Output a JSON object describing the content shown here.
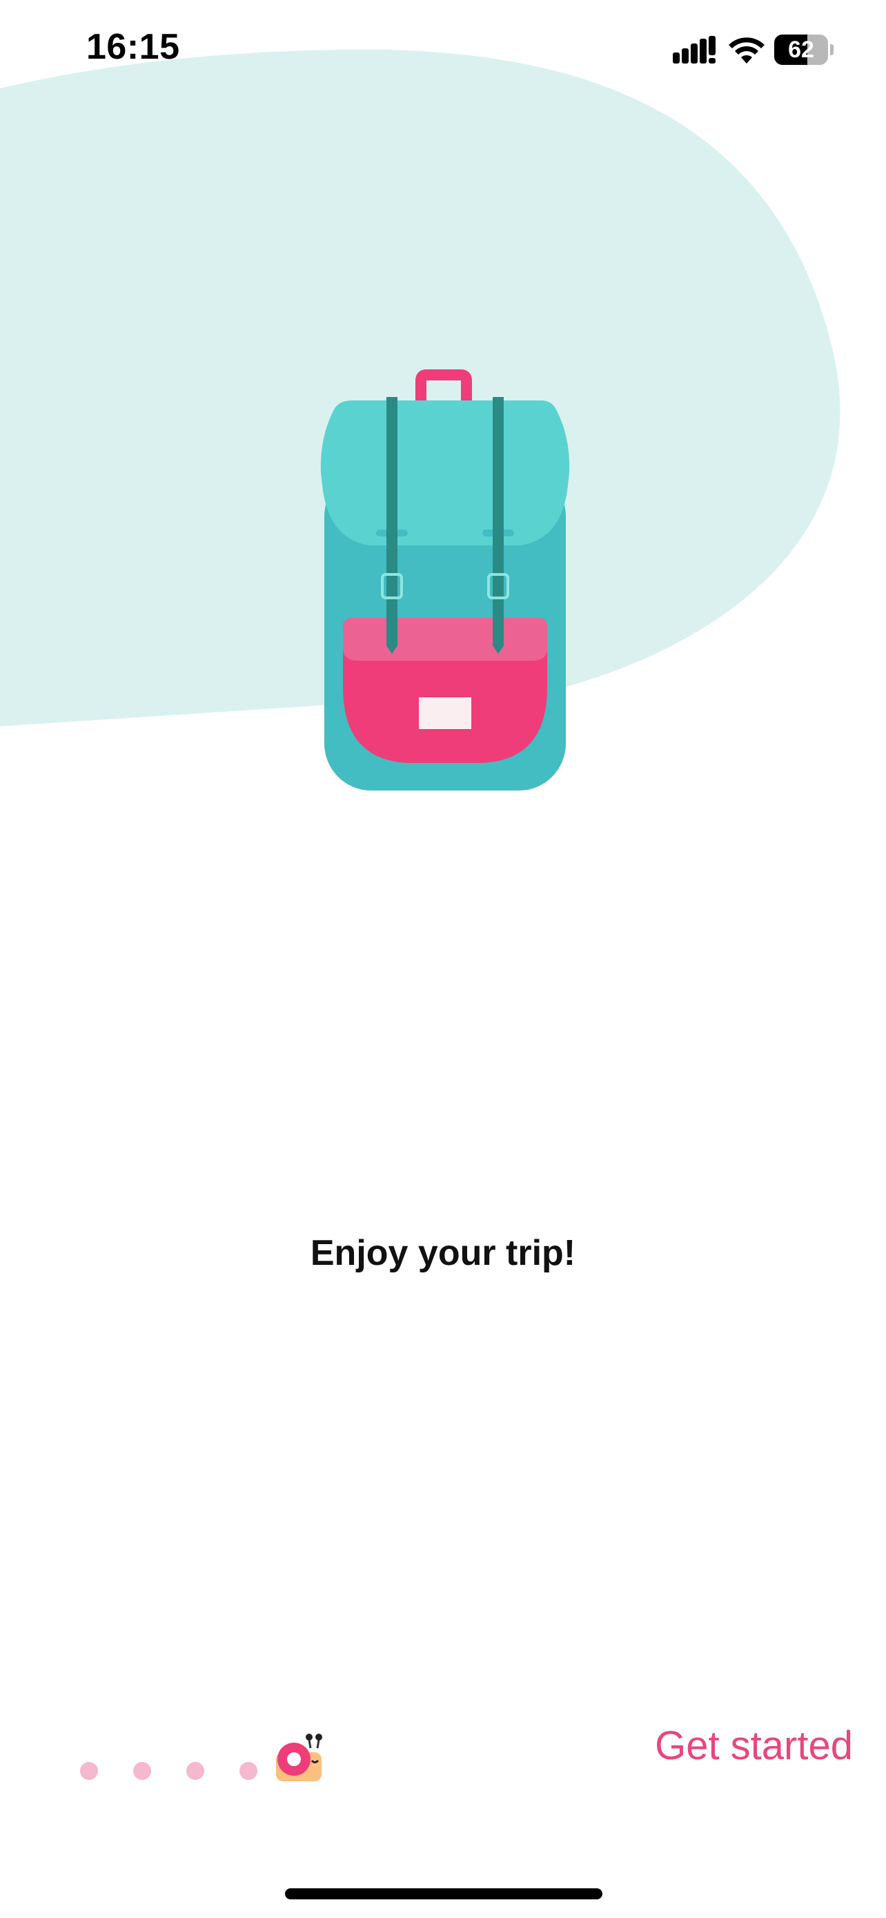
{
  "status_bar": {
    "time": "16:15",
    "battery_level": 62,
    "battery_label": "62"
  },
  "onboarding": {
    "headline": "Enjoy your trip!",
    "illustration": "backpack-illustration",
    "page_count": 5,
    "current_page": 5,
    "cta_label": "Get started"
  },
  "colors": {
    "accent": "#e8467d",
    "blob": "#daf1f0",
    "backpack_body": "#43bcc2",
    "backpack_flap": "#5ad3d0",
    "strap": "#2a8a84",
    "pocket": "#ee3d78",
    "dot": "#f5b8cf"
  }
}
